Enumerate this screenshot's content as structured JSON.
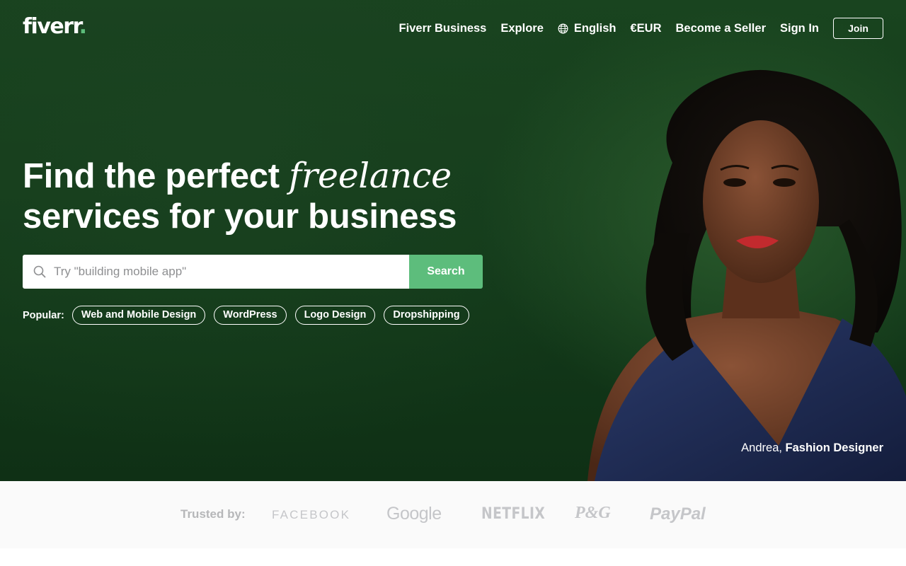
{
  "header": {
    "logo_text": "fiverr",
    "logo_dot": ".",
    "nav": {
      "business": "Fiverr Business",
      "explore": "Explore",
      "language": "English",
      "currency": "€EUR",
      "become_seller": "Become a Seller",
      "sign_in": "Sign In",
      "join": "Join"
    }
  },
  "hero": {
    "headline_part1": "Find the perfect ",
    "headline_em": "freelance",
    "headline_part2": "services for your business",
    "search": {
      "placeholder": "Try \"building mobile app\"",
      "button_label": "Search"
    },
    "popular": {
      "label": "Popular:",
      "tags": [
        "Web and Mobile Design",
        "WordPress",
        "Logo Design",
        "Dropshipping"
      ]
    },
    "caption": {
      "name": "Andrea, ",
      "role": "Fashion Designer"
    }
  },
  "trusted": {
    "label": "Trusted by:",
    "brands": [
      "FACEBOOK",
      "Google",
      "NETFLIX",
      "P&G",
      "PayPal"
    ]
  },
  "colors": {
    "brand_green": "#1dbf73",
    "search_button": "#5dbd7c",
    "hero_bg": "#17401d"
  }
}
